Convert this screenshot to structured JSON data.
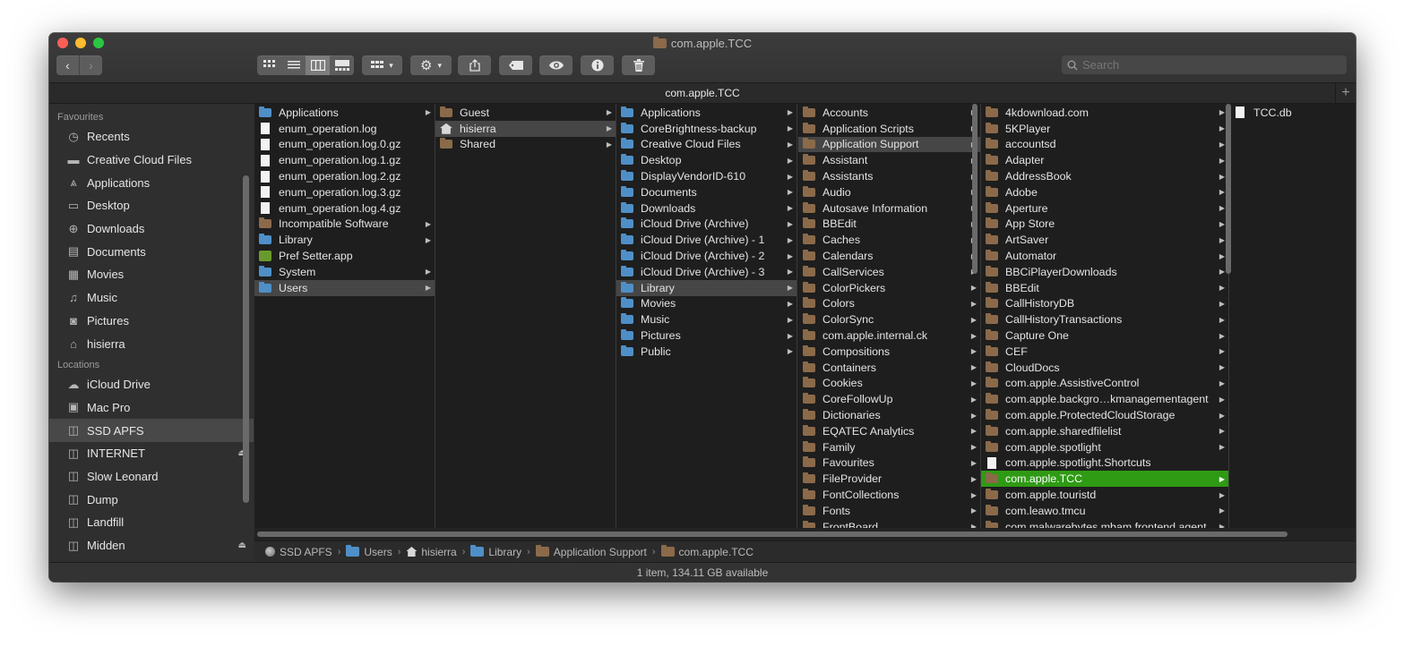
{
  "window": {
    "title": "com.apple.TCC",
    "tab_title": "com.apple.TCC",
    "status": "1 item, 134.11 GB available"
  },
  "toolbar": {
    "back": "‹",
    "forward": "›",
    "search_placeholder": "Search"
  },
  "sidebar": {
    "favourites_header": "Favourites",
    "favourites": [
      {
        "label": "Recents",
        "icon": "clock-icon"
      },
      {
        "label": "Creative Cloud Files",
        "icon": "folder-icon"
      },
      {
        "label": "Applications",
        "icon": "applications-icon"
      },
      {
        "label": "Desktop",
        "icon": "desktop-icon"
      },
      {
        "label": "Downloads",
        "icon": "download-icon"
      },
      {
        "label": "Documents",
        "icon": "document-icon"
      },
      {
        "label": "Movies",
        "icon": "film-icon"
      },
      {
        "label": "Music",
        "icon": "music-note-icon"
      },
      {
        "label": "Pictures",
        "icon": "camera-icon"
      },
      {
        "label": "hisierra",
        "icon": "home-icon"
      }
    ],
    "locations_header": "Locations",
    "locations": [
      {
        "label": "iCloud Drive",
        "icon": "cloud-icon",
        "eject": false
      },
      {
        "label": "Mac Pro",
        "icon": "computer-icon",
        "eject": false
      },
      {
        "label": "SSD APFS",
        "icon": "disk-icon",
        "eject": false,
        "selected": true
      },
      {
        "label": "INTERNET",
        "icon": "disk-icon",
        "eject": true
      },
      {
        "label": "Slow Leonard",
        "icon": "disk-icon",
        "eject": false
      },
      {
        "label": "Dump",
        "icon": "disk-icon",
        "eject": false
      },
      {
        "label": "Landfill",
        "icon": "disk-icon",
        "eject": false
      },
      {
        "label": "Midden",
        "icon": "disk-icon",
        "eject": true
      }
    ]
  },
  "columns": [
    {
      "items": [
        {
          "name": "Applications",
          "icon": "bfolder",
          "arrow": true
        },
        {
          "name": "enum_operation.log",
          "icon": "doc"
        },
        {
          "name": "enum_operation.log.0.gz",
          "icon": "doc"
        },
        {
          "name": "enum_operation.log.1.gz",
          "icon": "doc"
        },
        {
          "name": "enum_operation.log.2.gz",
          "icon": "doc"
        },
        {
          "name": "enum_operation.log.3.gz",
          "icon": "doc"
        },
        {
          "name": "enum_operation.log.4.gz",
          "icon": "doc"
        },
        {
          "name": "Incompatible Software",
          "icon": "folder",
          "arrow": true
        },
        {
          "name": "Library",
          "icon": "bfolder",
          "arrow": true
        },
        {
          "name": "Pref Setter.app",
          "icon": "app"
        },
        {
          "name": "System",
          "icon": "bfolder",
          "arrow": true
        },
        {
          "name": "Users",
          "icon": "bfolder",
          "arrow": true,
          "state": "hl"
        }
      ]
    },
    {
      "items": [
        {
          "name": "Guest",
          "icon": "folder",
          "arrow": true
        },
        {
          "name": "hisierra",
          "icon": "home",
          "arrow": true,
          "state": "hl"
        },
        {
          "name": "Shared",
          "icon": "folder",
          "arrow": true
        }
      ]
    },
    {
      "items": [
        {
          "name": "Applications",
          "icon": "bfolder",
          "arrow": true
        },
        {
          "name": "CoreBrightness-backup",
          "icon": "bfolder",
          "arrow": true
        },
        {
          "name": "Creative Cloud Files",
          "icon": "bfolder",
          "arrow": true
        },
        {
          "name": "Desktop",
          "icon": "bfolder",
          "arrow": true
        },
        {
          "name": "DisplayVendorID-610",
          "icon": "bfolder",
          "arrow": true
        },
        {
          "name": "Documents",
          "icon": "bfolder",
          "arrow": true
        },
        {
          "name": "Downloads",
          "icon": "bfolder",
          "arrow": true
        },
        {
          "name": "iCloud Drive (Archive)",
          "icon": "bfolder",
          "arrow": true
        },
        {
          "name": "iCloud Drive (Archive) - 1",
          "icon": "bfolder",
          "arrow": true
        },
        {
          "name": "iCloud Drive (Archive) - 2",
          "icon": "bfolder",
          "arrow": true
        },
        {
          "name": "iCloud Drive (Archive) - 3",
          "icon": "bfolder",
          "arrow": true
        },
        {
          "name": "Library",
          "icon": "bfolder",
          "arrow": true,
          "state": "hl"
        },
        {
          "name": "Movies",
          "icon": "bfolder",
          "arrow": true
        },
        {
          "name": "Music",
          "icon": "bfolder",
          "arrow": true
        },
        {
          "name": "Pictures",
          "icon": "bfolder",
          "arrow": true
        },
        {
          "name": "Public",
          "icon": "bfolder",
          "arrow": true
        }
      ]
    },
    {
      "items": [
        {
          "name": "Accounts",
          "icon": "folder",
          "arrow": true
        },
        {
          "name": "Application Scripts",
          "icon": "folder",
          "arrow": true
        },
        {
          "name": "Application Support",
          "icon": "folder",
          "arrow": true,
          "state": "hl"
        },
        {
          "name": "Assistant",
          "icon": "folder",
          "arrow": true
        },
        {
          "name": "Assistants",
          "icon": "folder",
          "arrow": true
        },
        {
          "name": "Audio",
          "icon": "folder",
          "arrow": true
        },
        {
          "name": "Autosave Information",
          "icon": "folder",
          "arrow": true
        },
        {
          "name": "BBEdit",
          "icon": "folder",
          "arrow": true
        },
        {
          "name": "Caches",
          "icon": "folder",
          "arrow": true
        },
        {
          "name": "Calendars",
          "icon": "folder",
          "arrow": true
        },
        {
          "name": "CallServices",
          "icon": "folder",
          "arrow": true
        },
        {
          "name": "ColorPickers",
          "icon": "folder",
          "arrow": true
        },
        {
          "name": "Colors",
          "icon": "folder",
          "arrow": true
        },
        {
          "name": "ColorSync",
          "icon": "folder",
          "arrow": true
        },
        {
          "name": "com.apple.internal.ck",
          "icon": "folder",
          "arrow": true
        },
        {
          "name": "Compositions",
          "icon": "folder",
          "arrow": true
        },
        {
          "name": "Containers",
          "icon": "folder",
          "arrow": true
        },
        {
          "name": "Cookies",
          "icon": "folder",
          "arrow": true
        },
        {
          "name": "CoreFollowUp",
          "icon": "folder",
          "arrow": true
        },
        {
          "name": "Dictionaries",
          "icon": "folder",
          "arrow": true
        },
        {
          "name": "EQATEC Analytics",
          "icon": "folder",
          "arrow": true
        },
        {
          "name": "Family",
          "icon": "folder",
          "arrow": true
        },
        {
          "name": "Favourites",
          "icon": "folder",
          "arrow": true
        },
        {
          "name": "FileProvider",
          "icon": "folder",
          "arrow": true
        },
        {
          "name": "FontCollections",
          "icon": "folder",
          "arrow": true
        },
        {
          "name": "Fonts",
          "icon": "folder",
          "arrow": true
        },
        {
          "name": "FrontBoard",
          "icon": "folder",
          "arrow": true
        }
      ]
    },
    {
      "items": [
        {
          "name": "4kdownload.com",
          "icon": "folder",
          "arrow": true
        },
        {
          "name": "5KPlayer",
          "icon": "folder",
          "arrow": true
        },
        {
          "name": "accountsd",
          "icon": "folder",
          "arrow": true
        },
        {
          "name": "Adapter",
          "icon": "folder",
          "arrow": true
        },
        {
          "name": "AddressBook",
          "icon": "folder",
          "arrow": true
        },
        {
          "name": "Adobe",
          "icon": "folder",
          "arrow": true
        },
        {
          "name": "Aperture",
          "icon": "folder",
          "arrow": true
        },
        {
          "name": "App Store",
          "icon": "folder",
          "arrow": true
        },
        {
          "name": "ArtSaver",
          "icon": "folder",
          "arrow": true
        },
        {
          "name": "Automator",
          "icon": "folder",
          "arrow": true
        },
        {
          "name": "BBCiPlayerDownloads",
          "icon": "folder",
          "arrow": true
        },
        {
          "name": "BBEdit",
          "icon": "folder",
          "arrow": true
        },
        {
          "name": "CallHistoryDB",
          "icon": "folder",
          "arrow": true
        },
        {
          "name": "CallHistoryTransactions",
          "icon": "folder",
          "arrow": true
        },
        {
          "name": "Capture One",
          "icon": "folder",
          "arrow": true
        },
        {
          "name": "CEF",
          "icon": "folder",
          "arrow": true
        },
        {
          "name": "CloudDocs",
          "icon": "folder",
          "arrow": true
        },
        {
          "name": "com.apple.AssistiveControl",
          "icon": "folder",
          "arrow": true
        },
        {
          "name": "com.apple.backgro…kmanagementagent",
          "icon": "folder",
          "arrow": true
        },
        {
          "name": "com.apple.ProtectedCloudStorage",
          "icon": "folder",
          "arrow": true
        },
        {
          "name": "com.apple.sharedfilelist",
          "icon": "folder",
          "arrow": true
        },
        {
          "name": "com.apple.spotlight",
          "icon": "folder",
          "arrow": true
        },
        {
          "name": "com.apple.spotlight.Shortcuts",
          "icon": "doc"
        },
        {
          "name": "com.apple.TCC",
          "icon": "folder",
          "arrow": true,
          "state": "act"
        },
        {
          "name": "com.apple.touristd",
          "icon": "folder",
          "arrow": true
        },
        {
          "name": "com.leawo.tmcu",
          "icon": "folder",
          "arrow": true
        },
        {
          "name": "com.malwarebytes.mbam.frontend.agent",
          "icon": "folder",
          "arrow": true
        }
      ]
    },
    {
      "items": [
        {
          "name": "TCC.db",
          "icon": "doc"
        }
      ]
    }
  ],
  "pathbar": [
    {
      "label": "SSD APFS",
      "icon": "disk"
    },
    {
      "label": "Users",
      "icon": "bfolder"
    },
    {
      "label": "hisierra",
      "icon": "home"
    },
    {
      "label": "Library",
      "icon": "bfolder"
    },
    {
      "label": "Application Support",
      "icon": "folder"
    },
    {
      "label": "com.apple.TCC",
      "icon": "folder"
    }
  ]
}
